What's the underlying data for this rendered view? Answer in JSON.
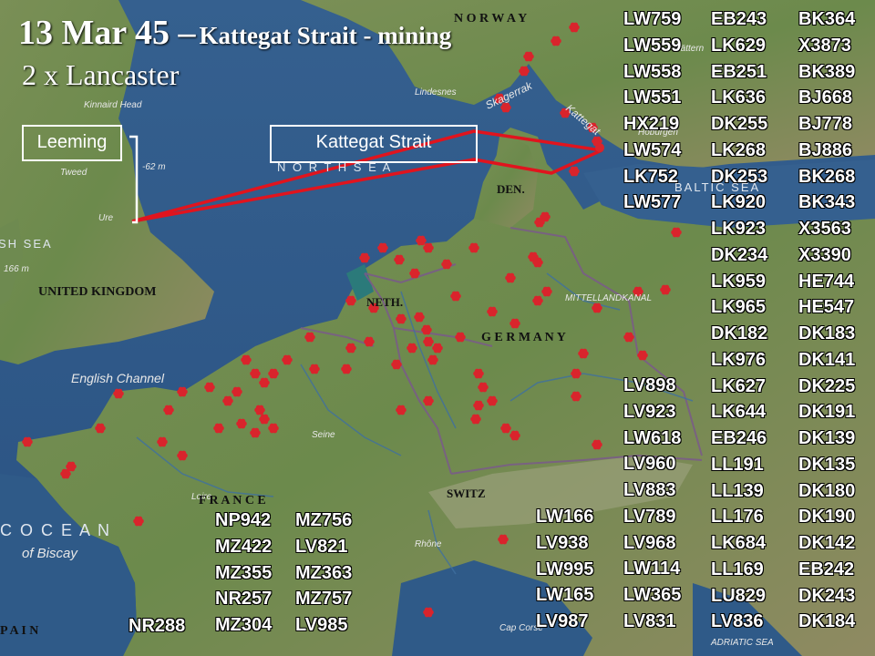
{
  "title": {
    "date": "13 Mar 45 –",
    "target": "Kattegat Strait - mining"
  },
  "subtitle": "2 x Lancaster",
  "base_label": "Leeming",
  "target_label": "Kattegat Strait",
  "map_labels": {
    "norway": "N O R W A Y",
    "uk": "UNITED KINGDOM",
    "den": "DEN.",
    "neth": "NETH.",
    "germany": "G E R M A N Y",
    "france": "F R A N C E",
    "switz": "SWITZ",
    "north_sea": "N O R T H   S E A",
    "irish_sea": "SH  SEA",
    "baltic_sea": "BALTIC SEA",
    "english_channel": "English Channel",
    "ocean": "C   O C E A N",
    "biscay": "of  Biscay",
    "spain": "P A I N",
    "skagerrak": "Skagerrak",
    "kattegat": "Kattegat",
    "lindesnes": "Lindesnes",
    "kinnaird": "Kinnaird Head",
    "tweed": "Tweed",
    "ure": "Ure",
    "depth1": "-62 m",
    "depth2": "166 m",
    "loire": "Loire",
    "seine": "Seine",
    "rhone": "Rhône",
    "cap_corse": "Cap Corse",
    "adriatic": "ADRIATIC SEA",
    "mittelland": "MITTELLANDKANAL",
    "hoburgen": "Hoburgen",
    "vattern": "Vättern"
  },
  "serial_columns": [
    [
      "LW759",
      "LW559",
      "LW558",
      "LW551",
      "HX219",
      "LW574",
      "LK752",
      "LW577"
    ],
    [
      "EB243",
      "LK629",
      "EB251",
      "LK636",
      "DK255",
      "LK268",
      "DK253",
      "LK920",
      "LK923",
      "DK234",
      "LK959",
      "LK965",
      "DK182",
      "LK976",
      "LK627",
      "LK644",
      "EB246",
      "LL191",
      "LL139",
      "LL176",
      "LK684",
      "LL169",
      "LU829",
      "LV836"
    ],
    [
      "BK364",
      "X3873",
      "BK389",
      "BJ668",
      "BJ778",
      "BJ886",
      "BK268",
      "BK343",
      "X3563",
      "X3390",
      "HE744",
      "HE547",
      "DK183",
      "DK141",
      "DK225",
      "DK191",
      "DK139",
      "DK135",
      "DK180",
      "DK190",
      "DK142",
      "EB242",
      "DK243",
      "DK184"
    ],
    [
      "LV898",
      "LV923",
      "LW618",
      "LV960",
      "LV883",
      "LV789",
      "LV968",
      "LW114",
      "LW365",
      "LV831"
    ],
    [
      "LW166",
      "LV938",
      "LW995",
      "LW165",
      "LV987"
    ],
    [
      "NP942",
      "MZ422",
      "MZ355",
      "NR257",
      "MZ304"
    ],
    [
      "MZ756",
      "LV821",
      "MZ363",
      "MZ757",
      "LV985"
    ],
    [
      "NR288"
    ]
  ],
  "colors": {
    "sea": "#2f5c8c",
    "land": "#6e8a50",
    "route": "#e0141e",
    "marker": "#d9242c",
    "border": "#7a5a8a"
  }
}
